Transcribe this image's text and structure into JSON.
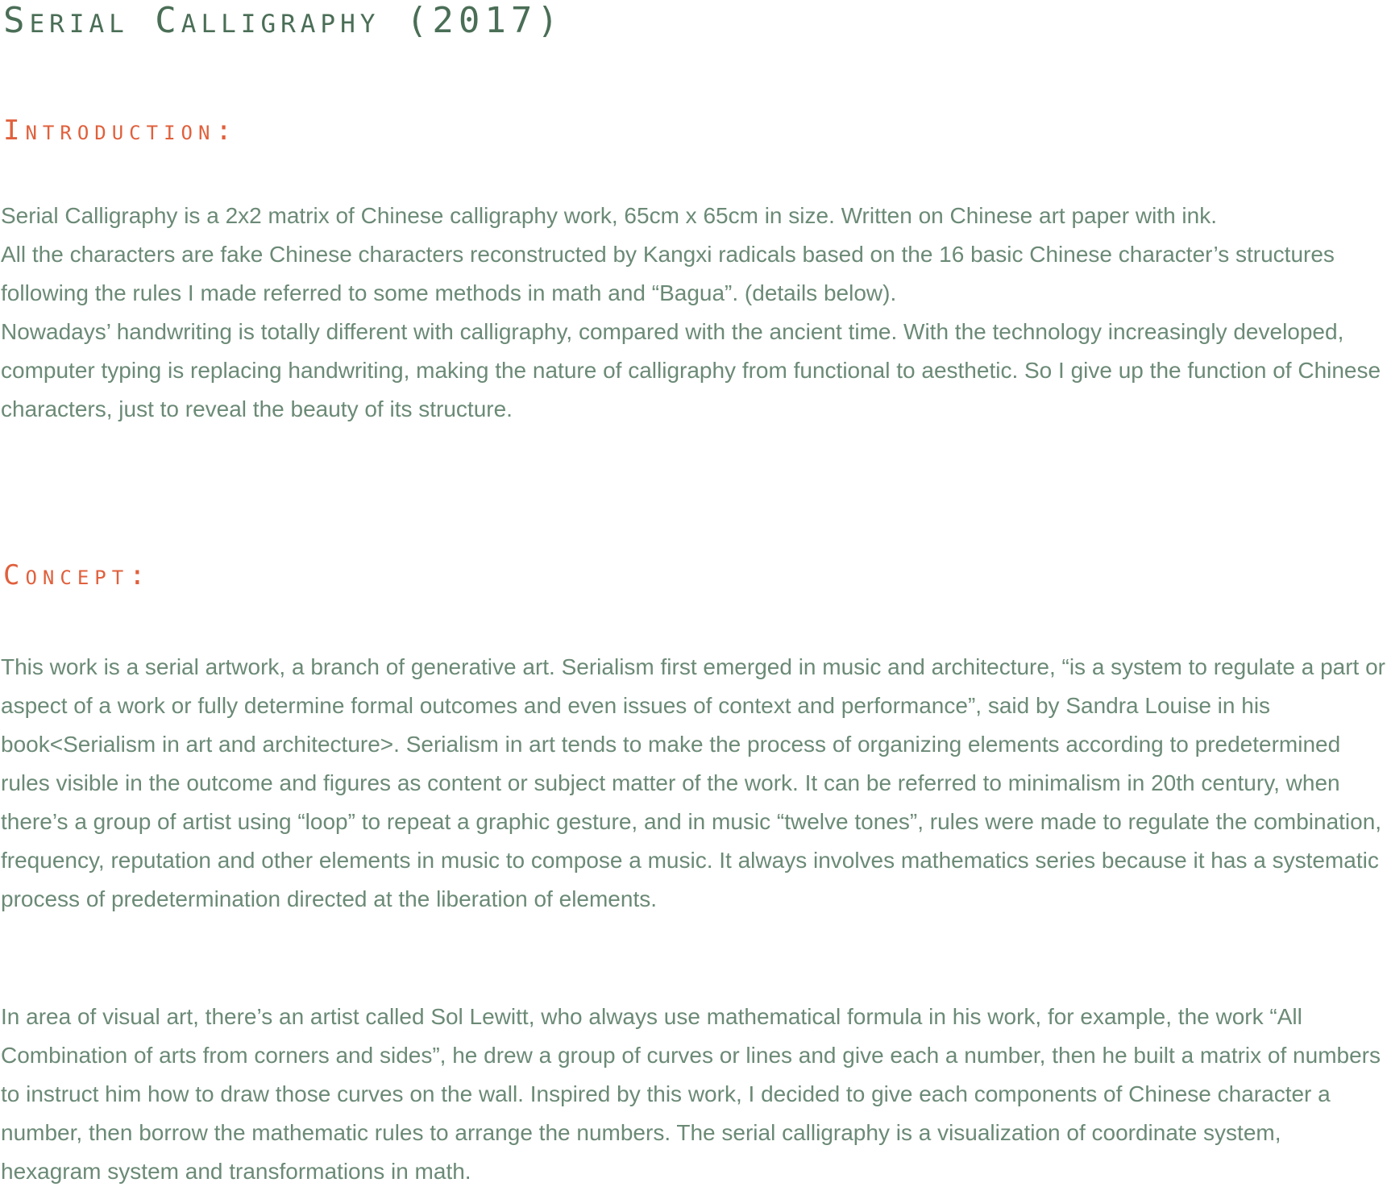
{
  "title": "Serial Calligraphy (2017)",
  "introduction": {
    "heading": "Introduction:",
    "paragraphs": [
      "Serial Calligraphy is a 2x2 matrix of Chinese calligraphy work, 65cm x 65cm in size. Written on Chinese art paper with ink.",
      "All the characters are fake Chinese characters reconstructed by Kangxi radicals based on the 16 basic Chinese character’s structures following the rules I made referred to some methods in math and “Bagua”. (details below).",
      "Nowadays’ handwriting is totally different with calligraphy, compared with the ancient time. With the technology increasingly developed, computer typing is replacing handwriting, making the nature of calligraphy from functional to aesthetic. So I give up the function of Chinese characters, just to reveal the beauty of its structure."
    ]
  },
  "concept": {
    "heading": "Concept:",
    "paragraphs": [
      "This work is a serial artwork, a branch of generative art. Serialism first emerged in music and architecture, “is a system to regulate a part or aspect of a work or fully determine formal outcomes and even issues of  context and performance”, said by Sandra Louise in his book<Serialism in art and architecture>. Serialism in art tends to make the process of organizing elements according to predetermined rules visible in the outcome and figures as content or subject matter of the work. It can be referred to minimalism in 20th century, when there’s a group of artist using “loop” to repeat a graphic gesture, and in music “twelve tones”, rules were made to regulate the combination, frequency, reputation and other elements in music to compose a music. It always involves mathematics series because it has a systematic process of predetermination directed at the liberation of elements.",
      "In area of visual art, there’s an artist called Sol Lewitt, who always use mathematical formula in his work, for example, the work “All Combination of arts from corners and sides”, he drew a group of curves or lines and give each a number, then he built a matrix of numbers to instruct him how to draw those curves on the wall. Inspired by this work, I decided to give each components of Chinese character a number, then borrow the mathematic rules to arrange the numbers. The serial calligraphy is a visualization of coordinate system, hexagram system and transformations in math."
    ]
  },
  "colors": {
    "title": "#4a6e56",
    "heading": "#e0603c",
    "body": "#6b8a76",
    "background": "#ffffff"
  }
}
